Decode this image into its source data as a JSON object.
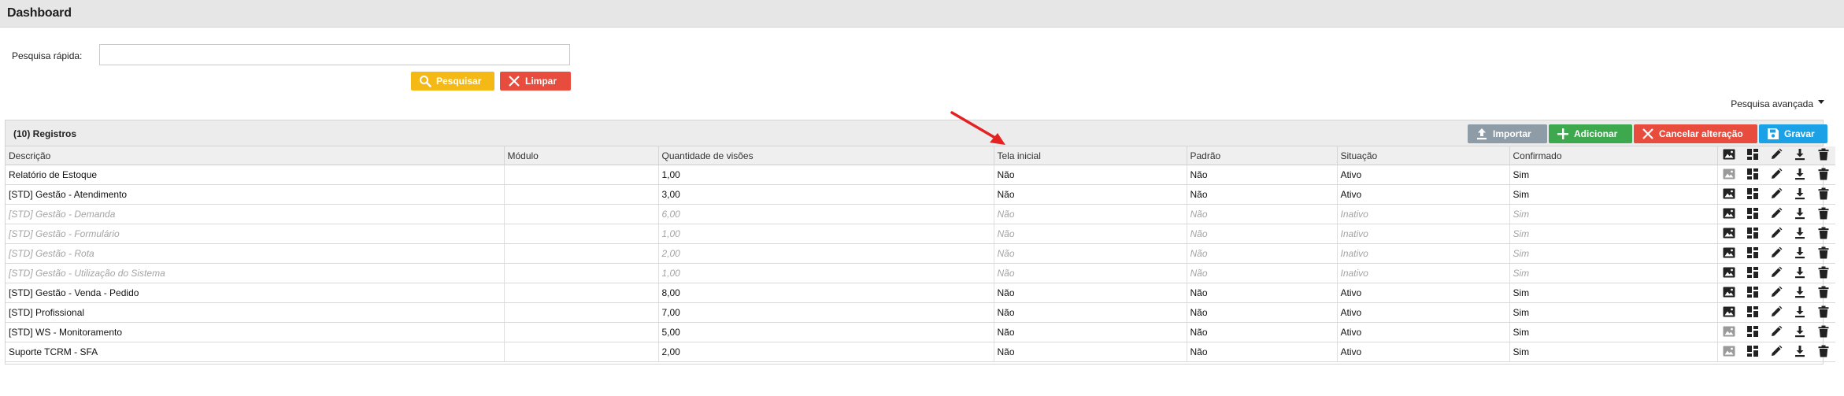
{
  "header": {
    "title": "Dashboard"
  },
  "search": {
    "label": "Pesquisa rápida:",
    "value": "",
    "search_button": "Pesquisar",
    "clear_button": "Limpar",
    "advanced_link": "Pesquisa avançada"
  },
  "panel": {
    "title": "(10) Registros",
    "buttons": {
      "import": "Importar",
      "add": "Adicionar",
      "cancel": "Cancelar alteração",
      "save": "Gravar"
    }
  },
  "table": {
    "columns": [
      "Descrição",
      "Módulo",
      "Quantidade de visões",
      "Tela inicial",
      "Padrão",
      "Situação",
      "Confirmado"
    ],
    "rows": [
      {
        "descricao": "Relatório de Estoque",
        "modulo": "",
        "quantidade": "1,00",
        "tela_inicial": "Não",
        "padrao": "Não",
        "situacao": "Ativo",
        "confirmado": "Sim",
        "inactive": false,
        "image_disabled": true
      },
      {
        "descricao": "[STD] Gestão - Atendimento",
        "modulo": "",
        "quantidade": "3,00",
        "tela_inicial": "Não",
        "padrao": "Não",
        "situacao": "Ativo",
        "confirmado": "Sim",
        "inactive": false,
        "image_disabled": false
      },
      {
        "descricao": "[STD] Gestão - Demanda",
        "modulo": "",
        "quantidade": "6,00",
        "tela_inicial": "Não",
        "padrao": "Não",
        "situacao": "Inativo",
        "confirmado": "Sim",
        "inactive": true,
        "image_disabled": false
      },
      {
        "descricao": "[STD] Gestão - Formulário",
        "modulo": "",
        "quantidade": "1,00",
        "tela_inicial": "Não",
        "padrao": "Não",
        "situacao": "Inativo",
        "confirmado": "Sim",
        "inactive": true,
        "image_disabled": false
      },
      {
        "descricao": "[STD] Gestão - Rota",
        "modulo": "",
        "quantidade": "2,00",
        "tela_inicial": "Não",
        "padrao": "Não",
        "situacao": "Inativo",
        "confirmado": "Sim",
        "inactive": true,
        "image_disabled": false
      },
      {
        "descricao": "[STD] Gestão - Utilização do Sistema",
        "modulo": "",
        "quantidade": "1,00",
        "tela_inicial": "Não",
        "padrao": "Não",
        "situacao": "Inativo",
        "confirmado": "Sim",
        "inactive": true,
        "image_disabled": false
      },
      {
        "descricao": "[STD] Gestão - Venda - Pedido",
        "modulo": "",
        "quantidade": "8,00",
        "tela_inicial": "Não",
        "padrao": "Não",
        "situacao": "Ativo",
        "confirmado": "Sim",
        "inactive": false,
        "image_disabled": false
      },
      {
        "descricao": "[STD] Profissional",
        "modulo": "",
        "quantidade": "7,00",
        "tela_inicial": "Não",
        "padrao": "Não",
        "situacao": "Ativo",
        "confirmado": "Sim",
        "inactive": false,
        "image_disabled": false
      },
      {
        "descricao": "[STD] WS - Monitoramento",
        "modulo": "",
        "quantidade": "5,00",
        "tela_inicial": "Não",
        "padrao": "Não",
        "situacao": "Ativo",
        "confirmado": "Sim",
        "inactive": false,
        "image_disabled": true
      },
      {
        "descricao": "Suporte TCRM - SFA",
        "modulo": "",
        "quantidade": "2,00",
        "tela_inicial": "Não",
        "padrao": "Não",
        "situacao": "Ativo",
        "confirmado": "Sim",
        "inactive": false,
        "image_disabled": true
      }
    ]
  },
  "row_actions": [
    "image-icon",
    "layout-icon",
    "edit-icon",
    "download-icon",
    "trash-icon"
  ],
  "colors": {
    "search_button": "#f5b915",
    "clear_button": "#e84c3d",
    "import_button": "#8e9ca7",
    "add_button": "#3ea84f",
    "cancel_button": "#e84c3d",
    "save_button": "#1ba2e6",
    "annotation_arrow": "#e32222",
    "inactive_text": "#a4a4a4"
  }
}
